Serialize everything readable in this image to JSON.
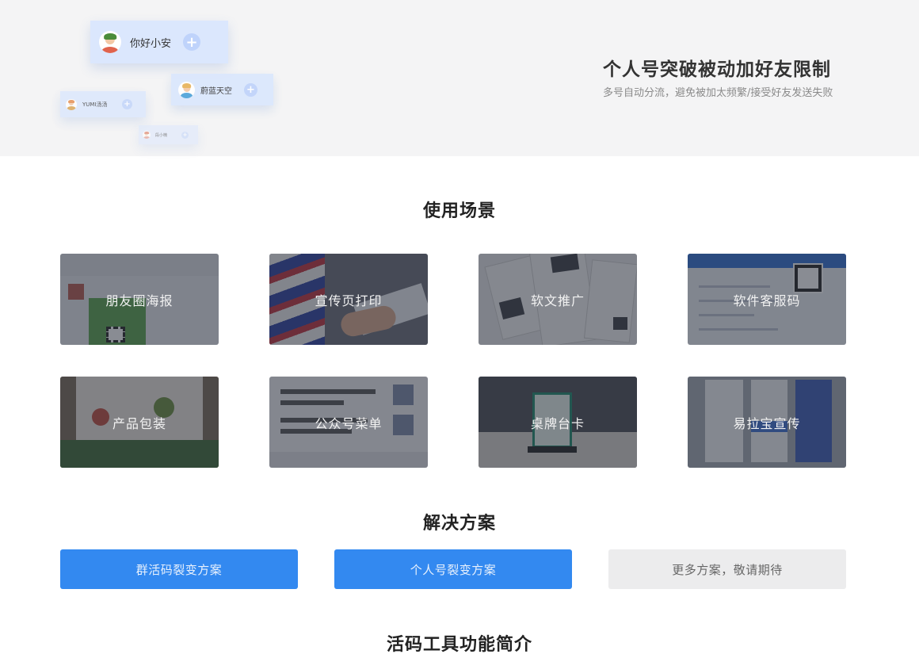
{
  "hero": {
    "title": "个人号突破被动加好友限制",
    "subtitle": "多号自动分流，避免被加太频繁/接受好友发送失败",
    "friend_cards": [
      {
        "name": "你好小安",
        "hair_color": "#4a8c3a",
        "shirt_color": "#e0634d"
      },
      {
        "name": "蔚蓝天空",
        "hair_color": "#e8b35c",
        "shirt_color": "#4fa3d9"
      },
      {
        "name": "YUMI汤汤",
        "hair_color": "#e58b4a",
        "shirt_color": "#d9a24f"
      },
      {
        "name": "段小楠",
        "hair_color": "#d9694a",
        "shirt_color": "#e08a7a"
      }
    ],
    "plus_icon": "+"
  },
  "sections": {
    "scenes_title": "使用场景",
    "solutions_title": "解决方案",
    "intro_title": "活码工具功能简介"
  },
  "scenes": [
    {
      "label": "朋友圈海报"
    },
    {
      "label": "宣传页打印"
    },
    {
      "label": "软文推广"
    },
    {
      "label": "软件客服码"
    },
    {
      "label": "产品包装"
    },
    {
      "label": "公众号菜单"
    },
    {
      "label": "桌牌台卡"
    },
    {
      "label": "易拉宝宣传"
    }
  ],
  "solutions": [
    {
      "label": "群活码裂变方案",
      "style": "primary"
    },
    {
      "label": "个人号裂变方案",
      "style": "primary"
    },
    {
      "label": "更多方案，敬请期待",
      "style": "disabled"
    }
  ],
  "colors": {
    "accent": "#3389f0",
    "hero_bg": "#f4f4f5",
    "card_bg": "#dbe7fd"
  }
}
